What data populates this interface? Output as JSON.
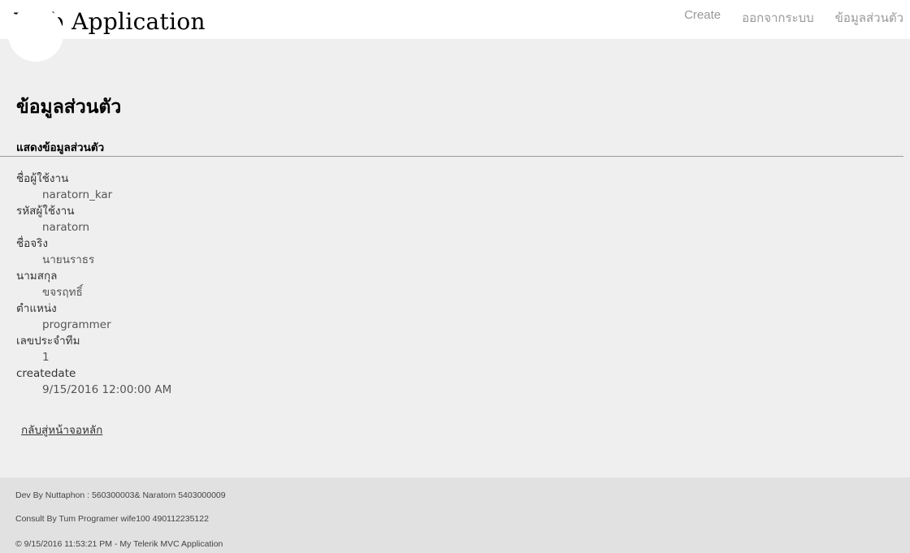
{
  "header": {
    "site_title": "Web Application",
    "nav": [
      "Create",
      "ออกจากระบบ",
      "ข้อมูลส่วนตัว"
    ]
  },
  "main": {
    "page_title": "ข้อมูลส่วนตัว",
    "section_title": "แสดงข้อมูลส่วนตัว",
    "fields": [
      {
        "label": "ชื่อผู้ใช้งาน",
        "value": "naratorn_kar"
      },
      {
        "label": "รหัสผู้ใช้งาน",
        "value": "naratorn"
      },
      {
        "label": "ชื่อจริง",
        "value": "นายนราธร"
      },
      {
        "label": "นามสกุล",
        "value": "ขจรฤทธิ์"
      },
      {
        "label": "ตำแหน่ง",
        "value": "programmer"
      },
      {
        "label": "เลขประจำทีม",
        "value": "1"
      },
      {
        "label": "createdate",
        "value": "9/15/2016 12:00:00 AM"
      }
    ],
    "back_link": "กลับสู่หน้าจอหลัก"
  },
  "footer": {
    "line1": "Dev By Nuttaphon : 560300003& Naratorn 5403000009",
    "line2": "Consult By Tum Programer wife100 490112235122",
    "line3": "© 9/15/2016 11:53:21 PM - My Telerik MVC Application"
  }
}
